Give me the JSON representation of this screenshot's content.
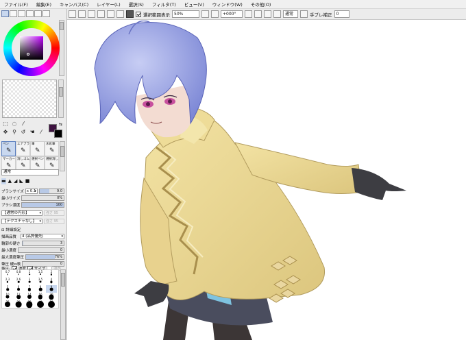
{
  "menu": [
    "ファイル(F)",
    "編集(E)",
    "キャンバス(C)",
    "レイヤー(L)",
    "選択(S)",
    "フィルタ(T)",
    "ビュー(V)",
    "ウィンドウ(W)",
    "その他(O)"
  ],
  "toolbar": {
    "selection_label": "選択範囲表示",
    "zoom": "50%",
    "rotation": "+000°",
    "blend_mode": "通常",
    "stabilizer_label": "手ブレ補正",
    "stabilizer_value": "0"
  },
  "colors": {
    "foreground": "#3d1240",
    "background": "#000000"
  },
  "brush_tools": [
    {
      "label": "ペン",
      "icon": "pen-icon"
    },
    {
      "label": "エアブラシ",
      "icon": "airbrush-icon"
    },
    {
      "label": "筆",
      "icon": "brush-icon"
    },
    {
      "label": "水彩筆",
      "icon": "watercolor-icon"
    },
    {
      "label": "マーカー",
      "icon": "marker-icon"
    },
    {
      "label": "消しゴム",
      "icon": "eraser-icon"
    },
    {
      "label": "選択ペン",
      "icon": "select-pen-icon"
    },
    {
      "label": "選択消し",
      "icon": "select-eraser-icon"
    }
  ],
  "brush_tool_top_row": [
    "ペン入力",
    "シャーペン",
    "クレヨン",
    "ぼかし"
  ],
  "brush_tool_mid_row": [
    "鉛筆",
    "エアブラシ",
    "筆",
    "水彩筆"
  ],
  "brush_tool_bottom_row": [
    "マーカー",
    "消しゴム",
    "選択ペン",
    "選択消し"
  ],
  "blend": "通常",
  "brush_size": {
    "label": "ブラシサイズ",
    "multiplier": "x 0.1",
    "value": "9.0"
  },
  "min_size": {
    "label": "最小サイズ",
    "value": "0%"
  },
  "brush_density": {
    "label": "ブラシ濃度",
    "value": "100"
  },
  "shape_select": "【通常の円形】",
  "texture_select": "【テクスチャなし】",
  "disabled_label": "強さ",
  "disabled_value": "95",
  "detail_section": "詳細設定",
  "quality": {
    "label": "描画品質",
    "value": "4 (品質優先)"
  },
  "edge_hardness": {
    "label": "輪郭の硬さ",
    "value": "3"
  },
  "min_density": {
    "label": "最小濃度",
    "value": "0"
  },
  "max_density_pressure": {
    "label": "最大濃度筆圧",
    "value": "76%"
  },
  "pressure_hard_soft": {
    "label": "筆圧 硬⇔軟",
    "value": "0"
  },
  "pressure_row": {
    "label": "筆圧:",
    "density": "濃度",
    "size": "サイズ",
    "blend": "混色"
  },
  "size_presets": [
    "0.7",
    "0.8",
    "1",
    "1.5",
    "2",
    "2.3",
    "2.6",
    "3",
    "3.5",
    "4",
    "5",
    "6",
    "7",
    "8",
    "9",
    "10",
    "12",
    "14",
    "16",
    "20",
    "25",
    "30",
    "35",
    "40",
    "50"
  ]
}
